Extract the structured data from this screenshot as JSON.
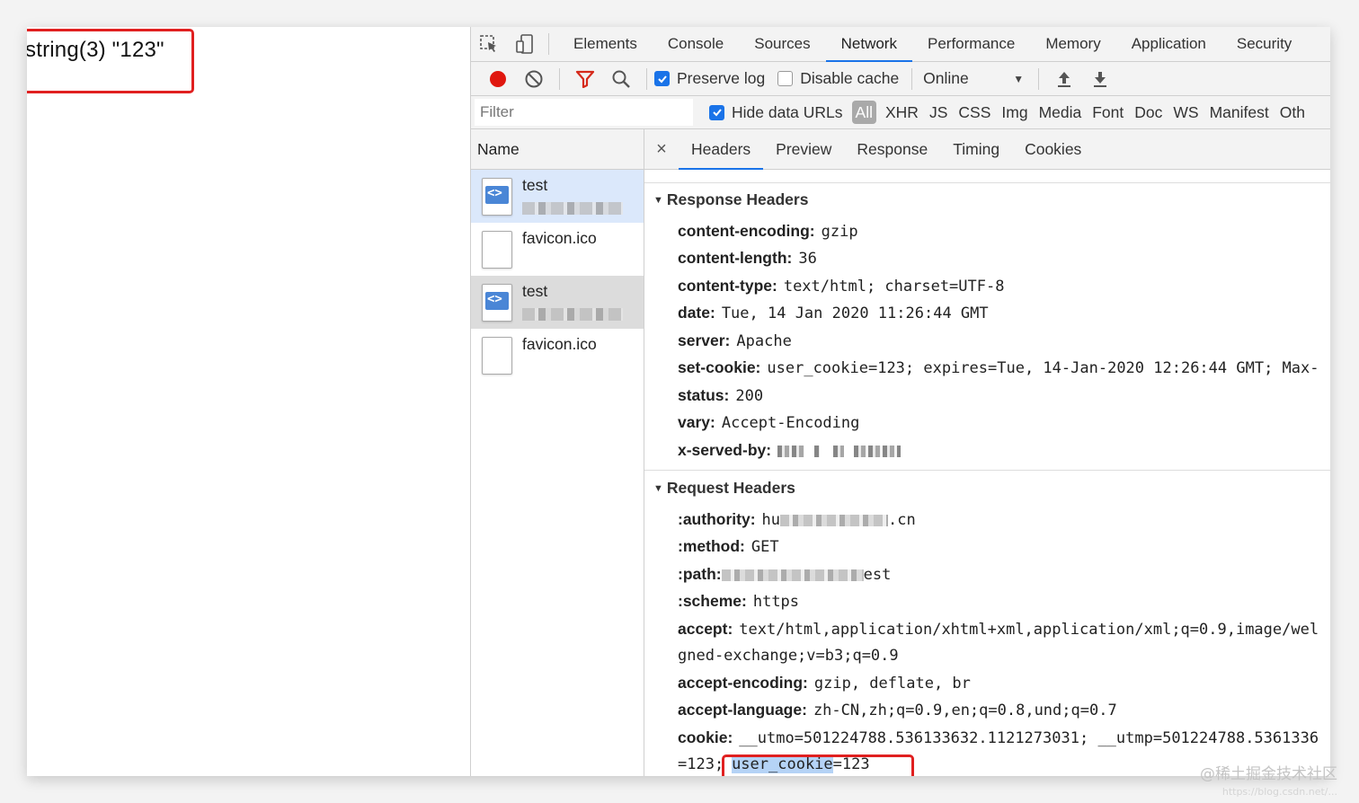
{
  "page_output": {
    "text": "string(3) \"123\""
  },
  "devtools": {
    "main_tabs": [
      "Elements",
      "Console",
      "Sources",
      "Network",
      "Performance",
      "Memory",
      "Application",
      "Security"
    ],
    "active_tab": "Network",
    "toolbar": {
      "preserve_log": "Preserve log",
      "preserve_log_checked": true,
      "disable_cache": "Disable cache",
      "disable_cache_checked": false,
      "throttle": "Online"
    },
    "filter": {
      "placeholder": "Filter",
      "hide_data_urls": "Hide data URLs",
      "types": [
        "All",
        "XHR",
        "JS",
        "CSS",
        "Img",
        "Media",
        "Font",
        "Doc",
        "WS",
        "Manifest",
        "Oth"
      ]
    },
    "request_list": {
      "header": "Name",
      "rows": [
        {
          "name": "test",
          "icon": "document-icon"
        },
        {
          "name": "favicon.ico",
          "icon": "file-icon"
        },
        {
          "name": "test",
          "icon": "document-icon"
        },
        {
          "name": "favicon.ico",
          "icon": "file-icon"
        }
      ]
    },
    "detail_tabs": [
      "Headers",
      "Preview",
      "Response",
      "Timing",
      "Cookies"
    ],
    "response_headers": {
      "title": "Response Headers",
      "items": [
        {
          "k": "content-encoding:",
          "v": "gzip"
        },
        {
          "k": "content-length:",
          "v": "36"
        },
        {
          "k": "content-type:",
          "v": "text/html; charset=UTF-8"
        },
        {
          "k": "date:",
          "v": "Tue, 14 Jan 2020 11:26:44 GMT"
        },
        {
          "k": "server:",
          "v": "Apache"
        },
        {
          "k": "set-cookie:",
          "v": "user_cookie=123; expires=Tue, 14-Jan-2020 12:26:44 GMT; Max-"
        },
        {
          "k": "status:",
          "v": "200"
        },
        {
          "k": "vary:",
          "v": "Accept-Encoding"
        },
        {
          "k": "x-served-by:",
          "v": ""
        }
      ]
    },
    "request_headers": {
      "title": "Request Headers",
      "authority_k": ":authority:",
      "authority_v1": "hu",
      "authority_v2": ".cn",
      "method_k": ":method:",
      "method_v": "GET",
      "path_k": ":path:",
      "path_v": "est",
      "scheme_k": ":scheme:",
      "scheme_v": "https",
      "accept_k": "accept:",
      "accept_v": "text/html,application/xhtml+xml,application/xml;q=0.9,image/wel",
      "accept_cont": "gned-exchange;v=b3;q=0.9",
      "accept_encoding_k": "accept-encoding:",
      "accept_encoding_v": "gzip, deflate, br",
      "accept_language_k": "accept-language:",
      "accept_language_v": "zh-CN,zh;q=0.9,en;q=0.8,und;q=0.7",
      "cookie_k": "cookie:",
      "cookie_v": "__utmo=501224788.536133632.1121273031; __utmp=501224788.5361336",
      "cookie_cont_prefix": "=123;",
      "cookie_sel": "user_cookie",
      "cookie_rest": "=123"
    }
  },
  "watermark": {
    "main": "@稀土掘金技术社区",
    "sub": "https://blog.csdn.net/..."
  }
}
